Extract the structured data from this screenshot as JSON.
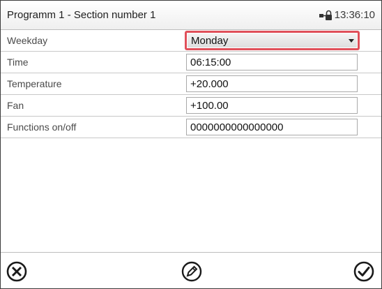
{
  "header": {
    "title": "Programm 1 - Section number 1",
    "time": "13:36:10",
    "status_icon": "lock-network-icon"
  },
  "form": {
    "rows": [
      {
        "label": "Weekday",
        "value": "Monday",
        "control": "select"
      },
      {
        "label": "Time",
        "value": "06:15:00",
        "control": "input"
      },
      {
        "label": "Temperature",
        "value": "+20.000",
        "control": "input"
      },
      {
        "label": "Fan",
        "value": "+100.00",
        "control": "input"
      },
      {
        "label": "Functions on/off",
        "value": "0000000000000000",
        "control": "input"
      }
    ]
  },
  "footer": {
    "buttons": [
      "cancel-icon",
      "edit-icon",
      "confirm-icon"
    ]
  },
  "colors": {
    "focus_border": "#e0505a",
    "field_border": "#a9a9a9"
  }
}
